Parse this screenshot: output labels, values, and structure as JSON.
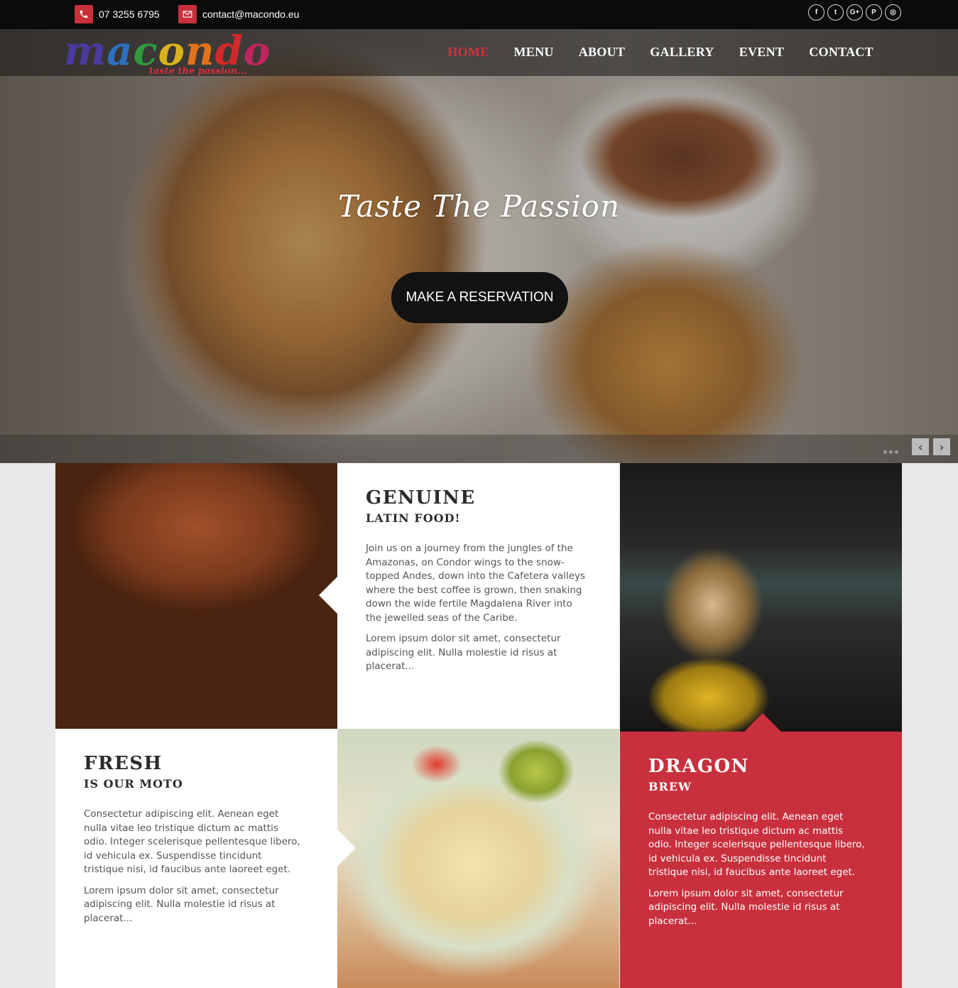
{
  "topbar": {
    "phone": "07 3255 6795",
    "email": "contact@macondo.eu",
    "socials": [
      {
        "icon": "facebook-icon",
        "glyph": "f"
      },
      {
        "icon": "twitter-icon",
        "glyph": "t"
      },
      {
        "icon": "google-plus-icon",
        "glyph": "G+"
      },
      {
        "icon": "pinterest-icon",
        "glyph": "P"
      },
      {
        "icon": "instagram-icon",
        "glyph": "◎"
      }
    ]
  },
  "logo": {
    "letters": [
      "m",
      "a",
      "c",
      "o",
      "n",
      "d",
      "o"
    ],
    "tagline": "taste the passion..."
  },
  "nav": {
    "items": [
      "HOME",
      "MENU",
      "ABOUT",
      "GALLERY",
      "EVENT",
      "CONTACT"
    ],
    "active": "HOME"
  },
  "hero": {
    "title": "Taste The Passion",
    "cta": "MAKE A RESERVATION",
    "prev": "‹",
    "next": "›"
  },
  "features": {
    "genuine": {
      "title": "GENUINE",
      "subtitle": "LATIN FOOD!",
      "p1": "Join us on a journey from the jungles of the Amazonas, on Condor wings to the snow-topped Andes, down into the Cafetera valleys where the best coffee is grown, then snaking down the wide fertile Magdalena River into the jewelled seas of the Caribe.",
      "p2": "Lorem ipsum dolor sit amet, consectetur adipiscing elit. Nulla molestie id risus at placerat..."
    },
    "fresh": {
      "title": "FRESH",
      "subtitle": "IS OUR MOTO",
      "p1": "Consectetur adipiscing elit. Aenean eget nulla vitae leo tristique dictum ac mattis odio. Integer scelerisque pellentesque libero, id vehicula ex. Suspendisse tincidunt tristique nisi, id faucibus ante laoreet eget.",
      "p2": "Lorem ipsum dolor sit amet, consectetur adipiscing elit. Nulla molestie id risus at placerat..."
    },
    "dragon": {
      "title": "DRAGON",
      "subtitle": "BREW",
      "p1": "Consectetur adipiscing elit. Aenean eget nulla vitae leo tristique dictum ac mattis odio. Integer scelerisque pellentesque libero, id vehicula ex. Suspendisse tincidunt tristique nisi, id faucibus ante laoreet eget.",
      "p2": "Lorem ipsum dolor sit amet, consectetur adipiscing elit. Nulla molestie id risus at placerat..."
    }
  },
  "colors": {
    "accent": "#c8303d",
    "topbar": "#0b0b0b",
    "cta_bg": "#121212"
  }
}
